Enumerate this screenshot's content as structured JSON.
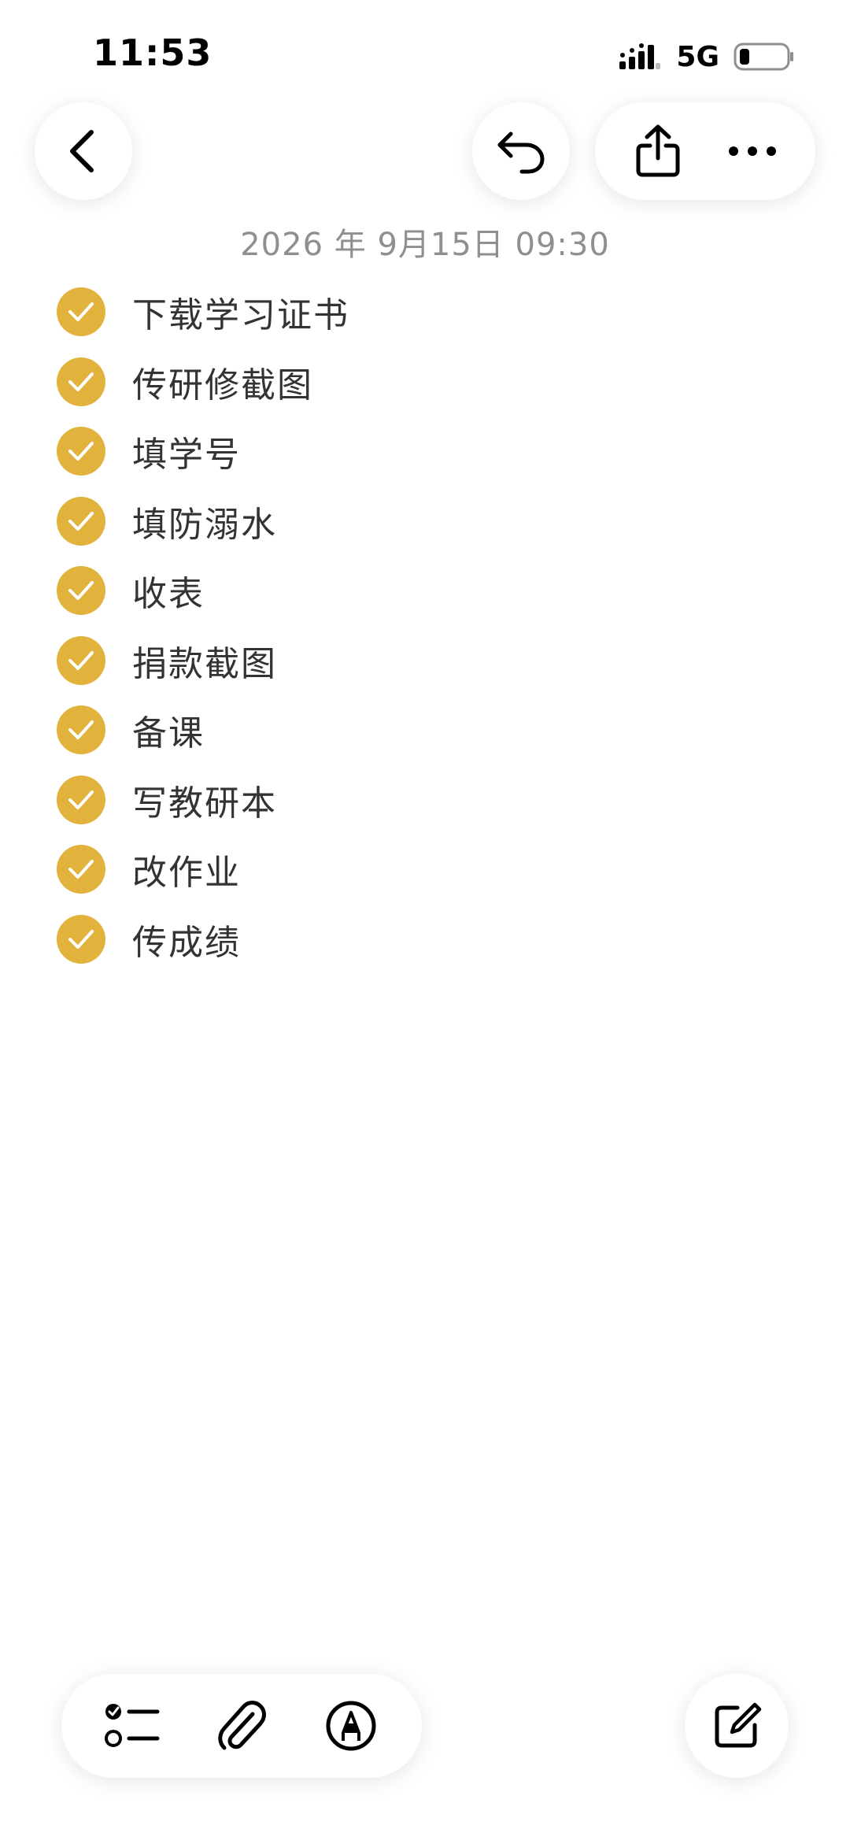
{
  "status_bar": {
    "time": "11:53",
    "network": "5G",
    "icons": [
      "signal-icon",
      "battery-icon"
    ]
  },
  "top_bar": {
    "icons": [
      "back-chevron-icon",
      "undo-icon",
      "share-icon",
      "more-dots-icon"
    ]
  },
  "note": {
    "date": "2026 年 9月15日 09:30",
    "items": [
      {
        "label": "下载学习证书",
        "checked": true
      },
      {
        "label": "传研修截图",
        "checked": true
      },
      {
        "label": "填学号",
        "checked": true
      },
      {
        "label": "填防溺水",
        "checked": true
      },
      {
        "label": "收表",
        "checked": true
      },
      {
        "label": "捐款截图",
        "checked": true
      },
      {
        "label": "备课",
        "checked": true
      },
      {
        "label": "写教研本",
        "checked": true
      },
      {
        "label": "改作业",
        "checked": true
      },
      {
        "label": "传成绩",
        "checked": true
      }
    ]
  },
  "bottom_toolbar": {
    "icons": [
      "checklist-icon",
      "paperclip-icon",
      "markup-pen-icon",
      "compose-icon"
    ]
  },
  "colors": {
    "accent": "#e2b33c",
    "date_text": "#8e8e93",
    "item_text": "#333333"
  }
}
